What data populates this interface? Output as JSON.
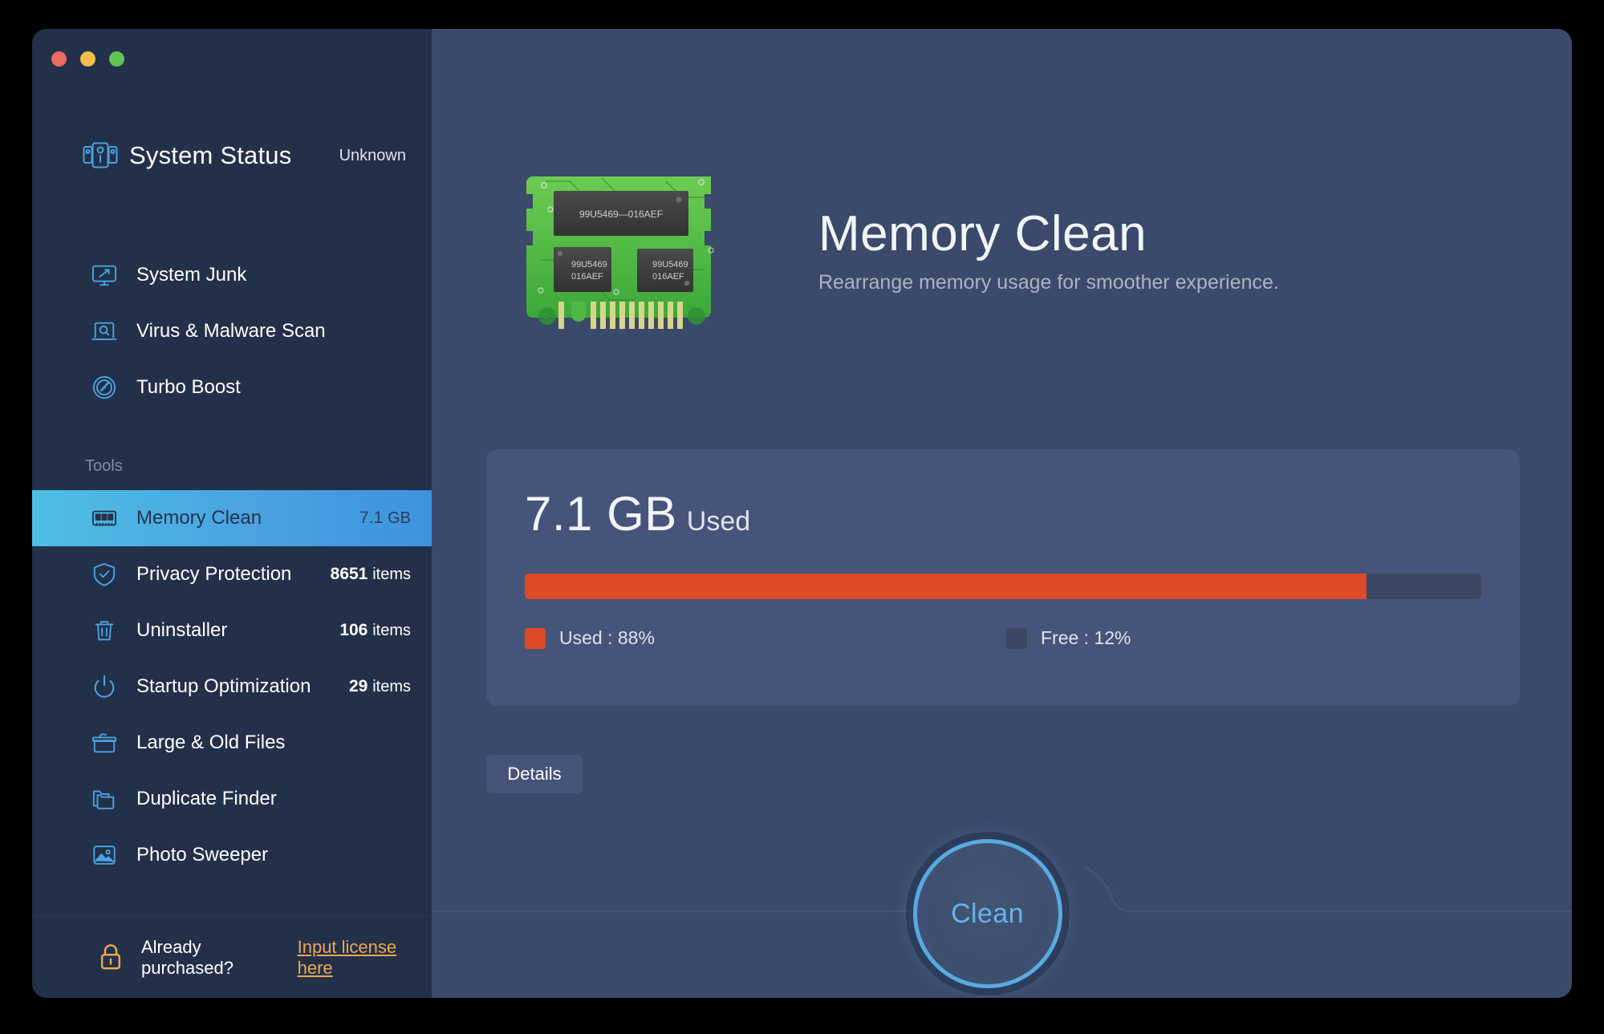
{
  "window": {
    "traffic_lights": [
      "close",
      "minimize",
      "zoom"
    ]
  },
  "sidebar": {
    "status": {
      "icon": "system-status-icon",
      "title": "System Status",
      "value": "Unknown"
    },
    "top_items": [
      {
        "icon": "monitor-arrow-icon",
        "label": "System Junk",
        "count": ""
      },
      {
        "icon": "laptop-search-icon",
        "label": "Virus & Malware Scan",
        "count": ""
      },
      {
        "icon": "speedometer-icon",
        "label": "Turbo Boost",
        "count": ""
      }
    ],
    "section_label": "Tools",
    "tool_items": [
      {
        "icon": "ram-stick-icon",
        "label": "Memory Clean",
        "count": "7.1",
        "unit": "GB",
        "selected": true
      },
      {
        "icon": "shield-check-icon",
        "label": "Privacy Protection",
        "count": "8651",
        "unit": "items",
        "selected": false
      },
      {
        "icon": "trash-icon",
        "label": "Uninstaller",
        "count": "106",
        "unit": "items",
        "selected": false
      },
      {
        "icon": "power-icon",
        "label": "Startup Optimization",
        "count": "29",
        "unit": "items",
        "selected": false
      },
      {
        "icon": "archive-box-icon",
        "label": "Large & Old Files",
        "count": "",
        "unit": "",
        "selected": false
      },
      {
        "icon": "folder-copy-icon",
        "label": "Duplicate Finder",
        "count": "",
        "unit": "",
        "selected": false
      },
      {
        "icon": "photo-icon",
        "label": "Photo Sweeper",
        "count": "",
        "unit": "",
        "selected": false
      }
    ],
    "license": {
      "icon": "lock-icon",
      "text": "Already purchased?",
      "link": "Input license here"
    }
  },
  "main": {
    "hero": {
      "illustration": "ram-module-illustration",
      "chip_labels": {
        "top": "99U5469—016AEF",
        "left_line1": "99U5469",
        "left_line2": "016AEF",
        "right_line1": "99U5469",
        "right_line2": "016AEF"
      },
      "title": "Memory Clean",
      "subtitle": "Rearrange memory usage for smoother experience."
    },
    "usage": {
      "amount": "7.1 GB",
      "amount_label": "Used",
      "used_legend": "Used : 88%",
      "free_legend": "Free : 12%"
    },
    "details_label": "Details",
    "clean_label": "Clean"
  },
  "colors": {
    "sidebar_bg": "#22304a",
    "main_bg": "#3b496a",
    "card_bg": "#46547a",
    "accent_blue": "#4aa3e0",
    "used_red": "#dc4a27",
    "free_gray": "#3a4763",
    "license_orange": "#f0a94e",
    "clean_blue": "#62b4ee"
  },
  "chart_data": {
    "type": "bar",
    "title": "Memory Usage",
    "categories": [
      "Used",
      "Free"
    ],
    "values": [
      88,
      12
    ],
    "unit": "%",
    "total_label": "7.1 GB Used",
    "ylim": [
      0,
      100
    ],
    "orientation": "horizontal-stacked",
    "legend": [
      "Used : 88%",
      "Free : 12%"
    ],
    "colors": [
      "#dc4a27",
      "#3a4763"
    ]
  }
}
